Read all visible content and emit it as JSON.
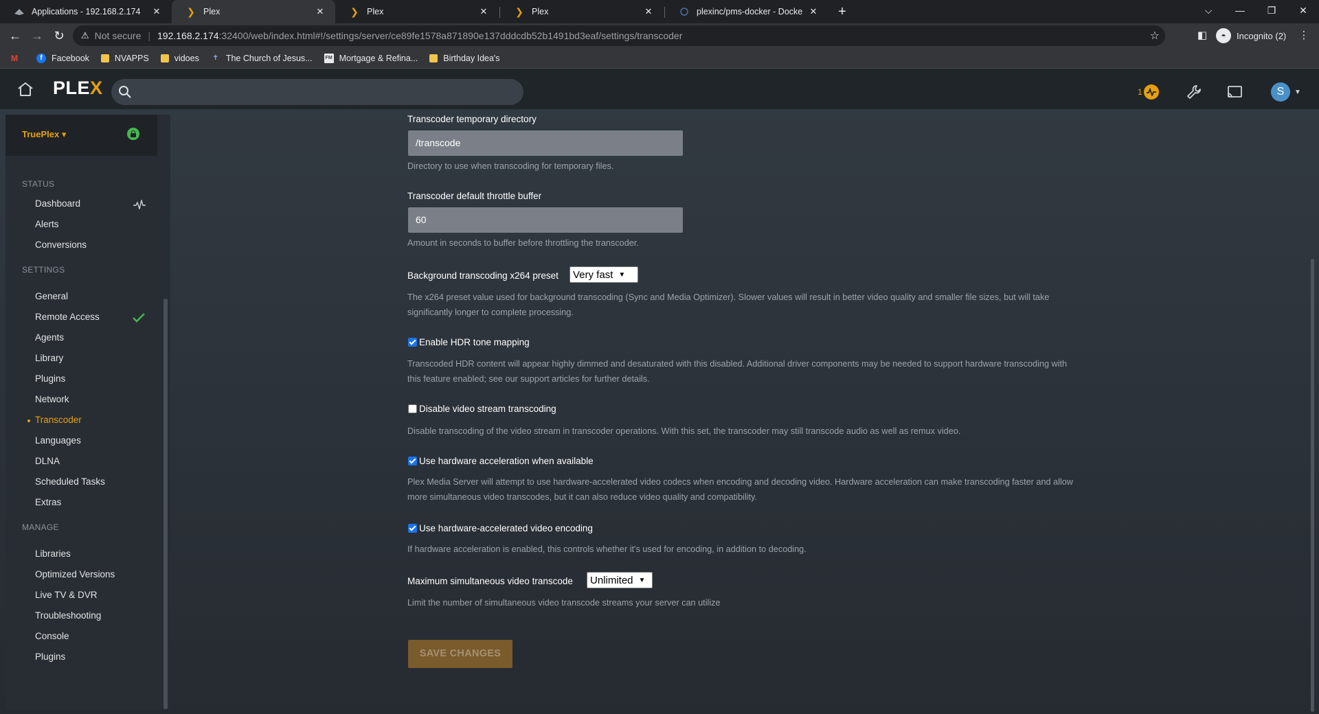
{
  "browser": {
    "tabs": [
      {
        "title": "Applications - 192.168.2.174",
        "icon": "apps-icon"
      },
      {
        "title": "Plex",
        "icon": "plex-icon"
      },
      {
        "title": "Plex",
        "icon": "plex-icon"
      },
      {
        "title": "Plex",
        "icon": "plex-icon"
      },
      {
        "title": "plexinc/pms-docker - Docker Ima",
        "icon": "docker-icon"
      }
    ],
    "address": {
      "security": "Not secure",
      "host": "192.168.2.174",
      "path": ":32400/web/index.html#!/settings/server/ce89fe1578a871890e137dddcdb52b1491bd3eaf/settings/transcoder"
    },
    "profile": "Incognito (2)",
    "bookmarks": [
      {
        "label": "",
        "icon": "gmail-icon"
      },
      {
        "label": "Facebook",
        "icon": "facebook-icon"
      },
      {
        "label": "NVAPPS",
        "icon": "folder-icon"
      },
      {
        "label": "vidoes",
        "icon": "folder-icon"
      },
      {
        "label": "The Church of Jesus...",
        "icon": "church-icon"
      },
      {
        "label": "Mortgage & Refina...",
        "icon": "fm-icon"
      },
      {
        "label": "Birthday Idea's",
        "icon": "folder-icon"
      }
    ]
  },
  "plex": {
    "logo_main": "PLE",
    "logo_accent": "X",
    "activity_count": "1",
    "avatar_letter": "S",
    "accent": "#e5a00d",
    "sidebar": {
      "server": "TruePlex",
      "sections": {
        "status": "STATUS",
        "settings": "SETTINGS",
        "manage": "MANAGE"
      },
      "status_items": [
        "Dashboard",
        "Alerts",
        "Conversions"
      ],
      "settings_items": [
        "General",
        "Remote Access",
        "Agents",
        "Library",
        "Plugins",
        "Network",
        "Transcoder",
        "Languages",
        "DLNA",
        "Scheduled Tasks",
        "Extras"
      ],
      "manage_items": [
        "Libraries",
        "Optimized Versions",
        "Live TV & DVR",
        "Troubleshooting",
        "Console",
        "Plugins"
      ],
      "active_item": "Transcoder"
    },
    "settings": {
      "temp_dir": {
        "label": "Transcoder temporary directory",
        "value": "/transcode",
        "help": "Directory to use when transcoding for temporary files."
      },
      "throttle": {
        "label": "Transcoder default throttle buffer",
        "value": "60",
        "help": "Amount in seconds to buffer before throttling the transcoder."
      },
      "x264_preset": {
        "label": "Background transcoding x264 preset",
        "value": "Very fast",
        "help": "The x264 preset value used for background transcoding (Sync and Media Optimizer). Slower values will result in better video quality and smaller file sizes, but will take significantly longer to complete processing."
      },
      "hdr": {
        "label": "Enable HDR tone mapping",
        "checked": true,
        "help": "Transcoded HDR content will appear highly dimmed and desaturated with this disabled. Additional driver components may be needed to support hardware transcoding with this feature enabled; see our support articles for further details."
      },
      "disable_video": {
        "label": "Disable video stream transcoding",
        "checked": false,
        "help": "Disable transcoding of the video stream in transcoder operations. With this set, the transcoder may still transcode audio as well as remux video."
      },
      "hw_accel": {
        "label": "Use hardware acceleration when available",
        "checked": true,
        "help": "Plex Media Server will attempt to use hardware-accelerated video codecs when encoding and decoding video. Hardware acceleration can make transcoding faster and allow more simultaneous video transcodes, but it can also reduce video quality and compatibility."
      },
      "hw_encode": {
        "label": "Use hardware-accelerated video encoding",
        "checked": true,
        "help": "If hardware acceleration is enabled, this controls whether it's used for encoding, in addition to decoding."
      },
      "max_transcode": {
        "label": "Maximum simultaneous video transcode",
        "value": "Unlimited",
        "help": "Limit the number of simultaneous video transcode streams your server can utilize"
      },
      "save_label": "SAVE CHANGES"
    }
  }
}
